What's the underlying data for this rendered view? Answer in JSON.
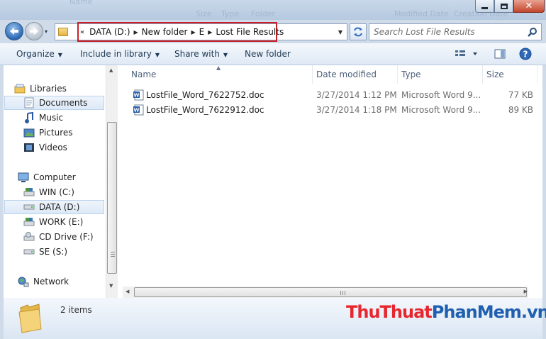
{
  "window": {
    "ghost_text": [
      "Name",
      "Size",
      "Type",
      "Folder",
      "Modified Date",
      "Creation Date"
    ],
    "min_icon": "minimize-icon",
    "max_icon": "maximize-icon",
    "close_icon": "close-icon"
  },
  "nav": {
    "recent_glyph": "▾",
    "breadcrumb_lead": "«",
    "breadcrumbs": [
      "DATA (D:)",
      "New folder",
      "E",
      "Lost File Results"
    ],
    "search_placeholder": "Search Lost File Results"
  },
  "toolbar": {
    "organize": "Organize",
    "include_library": "Include in library",
    "share_with": "Share with",
    "new_folder": "New folder",
    "help": "?"
  },
  "sidebar": {
    "libraries": "Libraries",
    "library_items": [
      "Documents",
      "Music",
      "Pictures",
      "Videos"
    ],
    "computer": "Computer",
    "drives": [
      "WIN (C:)",
      "DATA (D:)",
      "WORK (E:)",
      "CD Drive (F:)",
      "SE (S:)"
    ],
    "network": "Network",
    "selected_library": "Documents",
    "selected_drive": "DATA (D:)"
  },
  "files": {
    "columns": [
      "Name",
      "Date modified",
      "Type",
      "Size"
    ],
    "rows": [
      {
        "name": "LostFile_Word_7622752.doc",
        "date": "3/27/2014 1:12 PM",
        "type": "Microsoft Word 9...",
        "size": "77 KB"
      },
      {
        "name": "LostFile_Word_7622912.doc",
        "date": "3/27/2014 1:18 PM",
        "type": "Microsoft Word 9...",
        "size": "89 KB"
      }
    ]
  },
  "status": {
    "item_count": "2 items"
  },
  "watermark": {
    "part1": "Thu",
    "part2": "Thuat",
    "part3": "PhanMem",
    "part4": ".vn",
    "color_red": "#e8262d",
    "color_blue": "#1f5fb0"
  }
}
